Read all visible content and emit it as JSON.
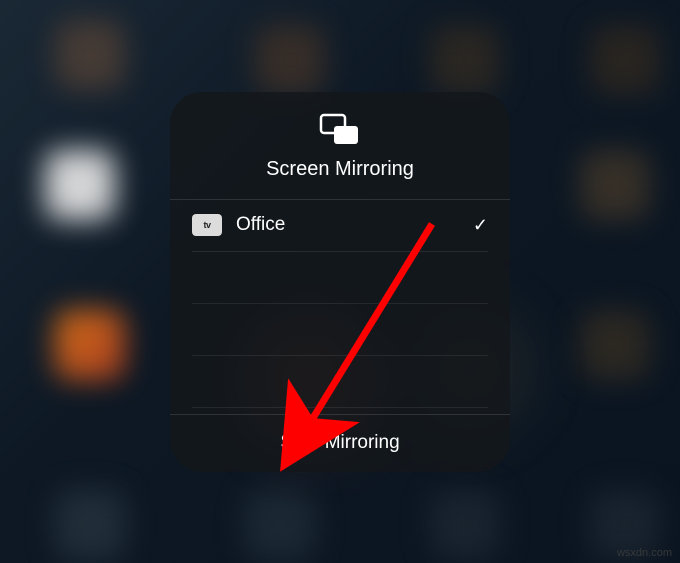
{
  "panel": {
    "title": "Screen Mirroring",
    "devices": [
      {
        "name": "Office",
        "icon_label": "tv",
        "selected": true
      }
    ],
    "stop_label": "Stop Mirroring"
  },
  "watermark": "wsxdn.com",
  "colors": {
    "annotation_arrow": "#ff0000"
  }
}
